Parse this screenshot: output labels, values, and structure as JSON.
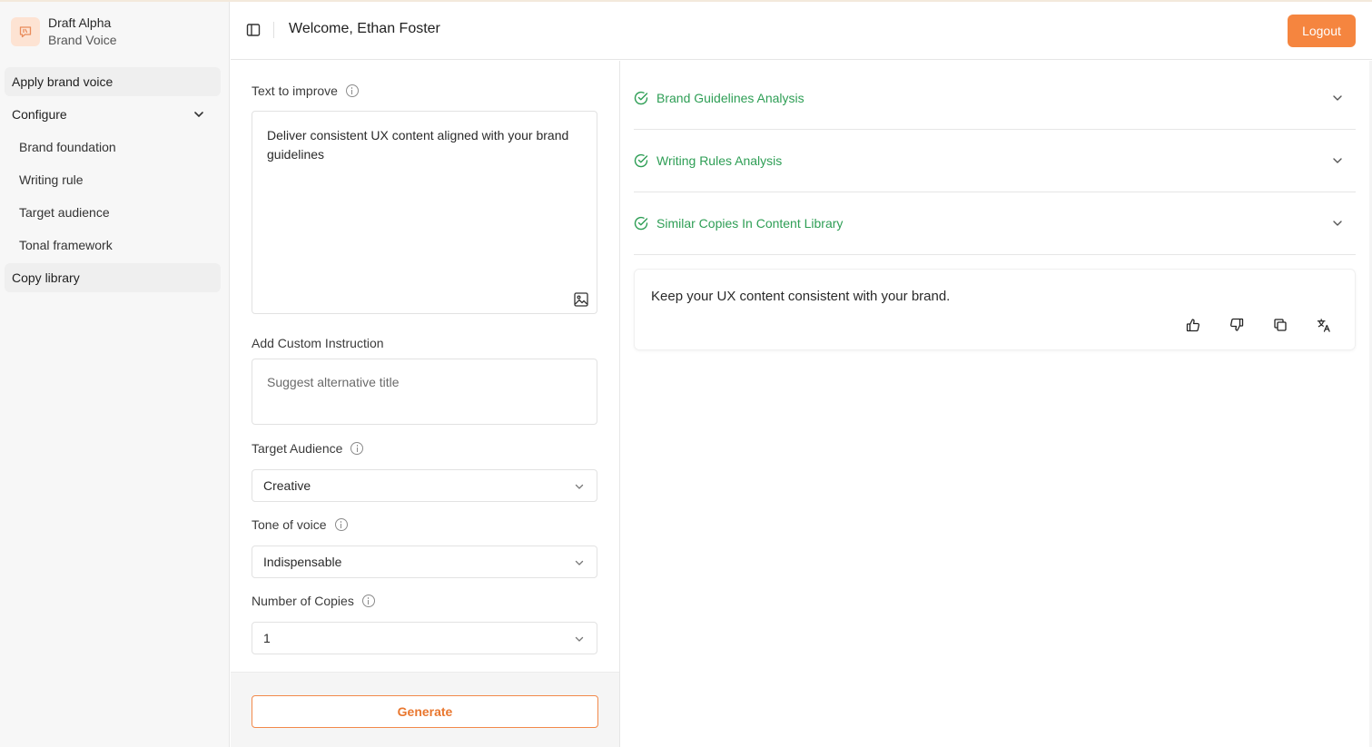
{
  "brand": {
    "name": "Draft Alpha",
    "subtitle": "Brand Voice"
  },
  "sidebar": {
    "items": [
      {
        "label": "Apply brand voice"
      },
      {
        "label": "Configure"
      },
      {
        "label": "Copy library"
      }
    ],
    "configure_items": [
      {
        "label": "Brand foundation"
      },
      {
        "label": "Writing rule"
      },
      {
        "label": "Target audience"
      },
      {
        "label": "Tonal framework"
      }
    ]
  },
  "header": {
    "welcome": "Welcome, Ethan Foster",
    "logout_label": "Logout"
  },
  "form": {
    "text_label": "Text to improve",
    "text_value": "Deliver consistent UX content aligned with your brand guidelines",
    "instruction_label": "Add Custom Instruction",
    "instruction_placeholder": "Suggest alternative title",
    "audience_label": "Target Audience",
    "audience_value": "Creative",
    "tone_label": "Tone of voice",
    "tone_value": "Indispensable",
    "copies_label": "Number of Copies",
    "copies_value": "1",
    "generate_label": "Generate"
  },
  "results": {
    "accordions": [
      {
        "title": "Brand Guidelines Analysis"
      },
      {
        "title": "Writing Rules Analysis"
      },
      {
        "title": "Similar Copies In Content Library"
      }
    ],
    "output_text": "Keep your UX content consistent with your brand."
  },
  "colors": {
    "accent": "#f5853f",
    "success": "#2e9e55"
  },
  "icons": [
    "chat-icon",
    "sidebar-toggle-icon",
    "chevron-down-icon",
    "info-icon",
    "image-icon",
    "check-circle-icon",
    "thumbs-up-icon",
    "thumbs-down-icon",
    "copy-icon",
    "translate-icon"
  ]
}
